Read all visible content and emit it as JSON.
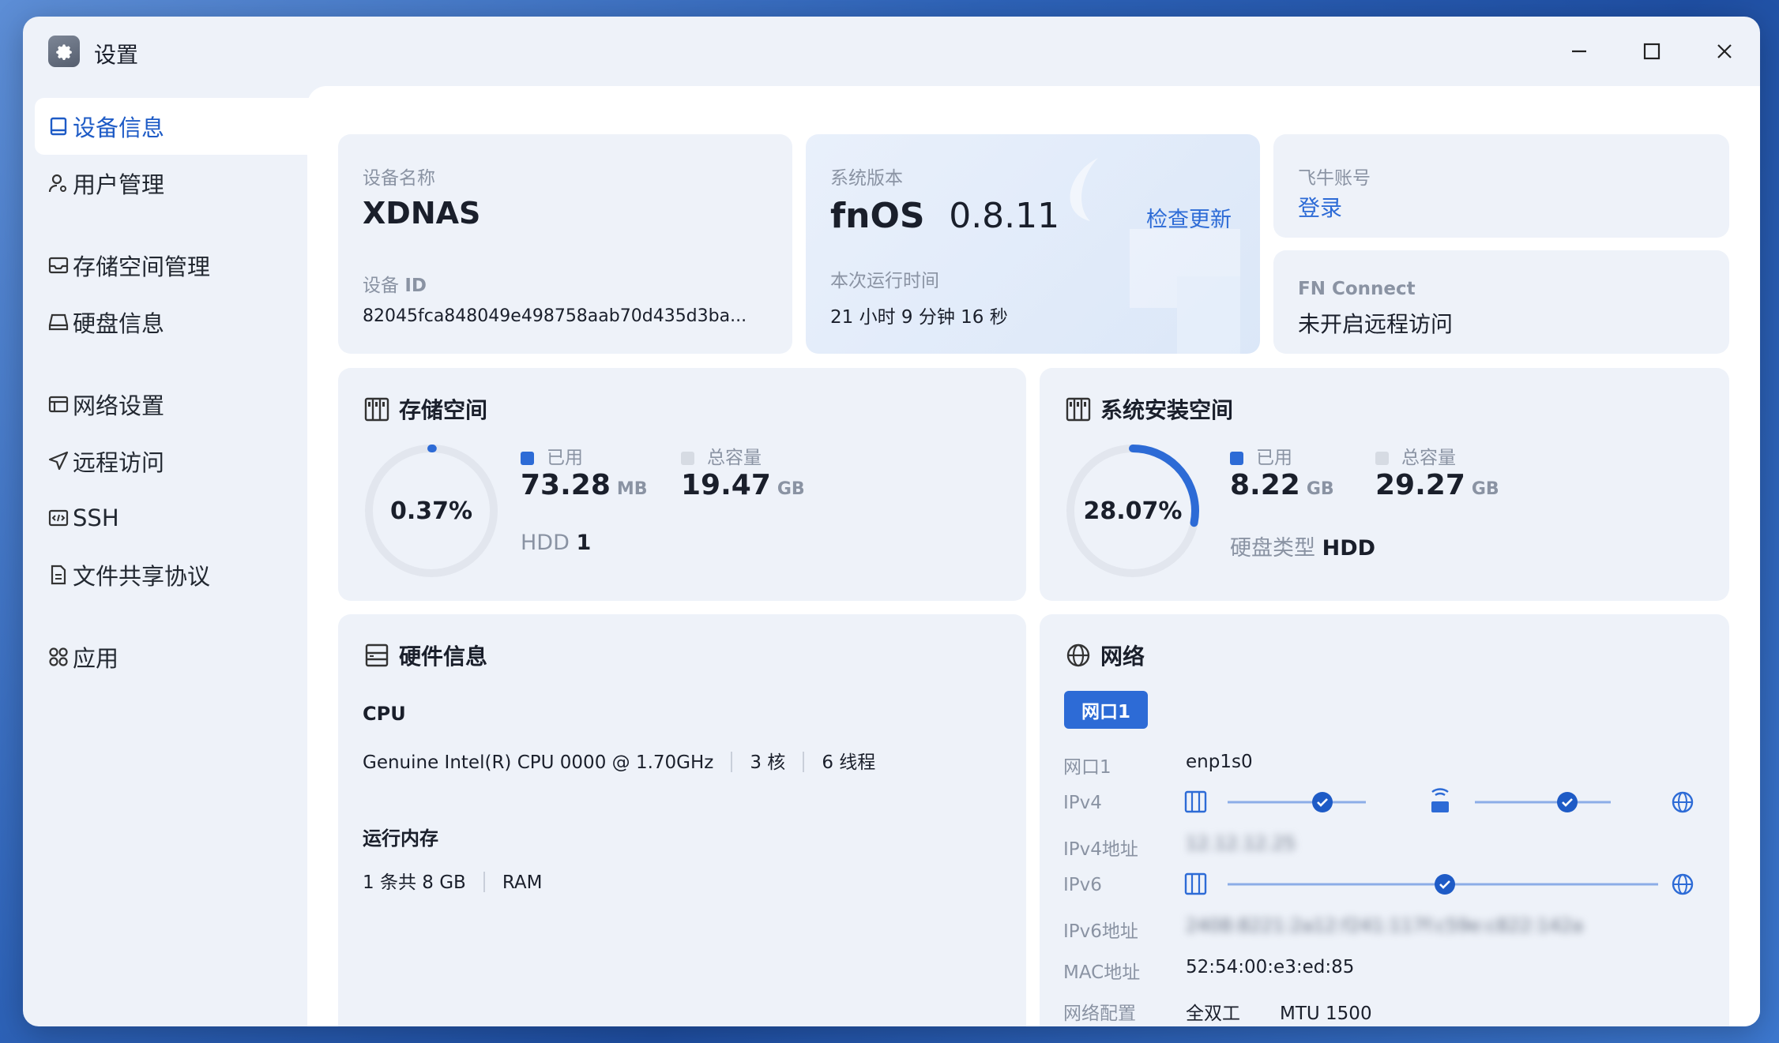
{
  "window": {
    "title": "设置"
  },
  "sidebar": {
    "items": [
      {
        "label": "设备信息",
        "icon": "device-icon",
        "active": true
      },
      {
        "label": "用户管理",
        "icon": "user-gear-icon"
      },
      {
        "label": "存储空间管理",
        "icon": "storage-icon"
      },
      {
        "label": "硬盘信息",
        "icon": "disk-icon"
      },
      {
        "label": "网络设置",
        "icon": "network-settings-icon"
      },
      {
        "label": "远程访问",
        "icon": "send-icon"
      },
      {
        "label": "SSH",
        "icon": "code-icon"
      },
      {
        "label": "文件共享协议",
        "icon": "document-icon"
      },
      {
        "label": "应用",
        "icon": "apps-icon"
      }
    ]
  },
  "device": {
    "name_label": "设备名称",
    "name": "XDNAS",
    "id_label_prefix": "设备",
    "id_label_suffix": "ID",
    "id": "82045fca848049e498758aab70d435d3ba..."
  },
  "system": {
    "version_label": "系统版本",
    "os": "fnOS",
    "version": "0.8.11",
    "check_update": "检查更新",
    "uptime_label": "本次运行时间",
    "uptime": "21 小时 9 分钟 16 秒"
  },
  "account": {
    "label": "飞牛账号",
    "login": "登录"
  },
  "fn_connect": {
    "label": "FN Connect",
    "status": "未开启远程访问"
  },
  "storage": {
    "title": "存储空间",
    "percent": "0.37%",
    "percent_value": 0.37,
    "used_label": "已用",
    "used_value": "73.28",
    "used_unit": "MB",
    "total_label": "总容量",
    "total_value": "19.47",
    "total_unit": "GB",
    "disk_type": "HDD",
    "disk_count": "1"
  },
  "system_space": {
    "title": "系统安装空间",
    "percent": "28.07%",
    "percent_value": 28.07,
    "used_label": "已用",
    "used_value": "8.22",
    "used_unit": "GB",
    "total_label": "总容量",
    "total_value": "29.27",
    "total_unit": "GB",
    "disk_type_label": "硬盘类型",
    "disk_type": "HDD"
  },
  "hardware": {
    "title": "硬件信息",
    "cpu_label": "CPU",
    "cpu_model": "Genuine Intel(R) CPU 0000 @ 1.70GHz",
    "cpu_cores": "3 核",
    "cpu_threads": "6 线程",
    "mem_label": "运行内存",
    "mem_amount": "1 条共 8 GB",
    "mem_type": "RAM"
  },
  "network": {
    "title": "网络",
    "tab": "网口1",
    "port_label": "网口1",
    "port_value": "enp1s0",
    "ipv4_label": "IPv4",
    "ipv4_addr_label": "IPv4地址",
    "ipv4_addr": "12.12.12.25",
    "ipv6_label": "IPv6",
    "ipv6_addr_label": "IPv6地址",
    "ipv6_addr": "2408:8221:2a12:f241:117f:c59e:c822:142a",
    "mac_label": "MAC地址",
    "mac": "52:54:00:e3:ed:85",
    "config_label": "网络配置",
    "duplex": "全双工",
    "mtu": "MTU 1500"
  },
  "colors": {
    "accent": "#2d6bd6",
    "ring_track": "#e2e6ee",
    "window_bg": "#eef2f9"
  }
}
